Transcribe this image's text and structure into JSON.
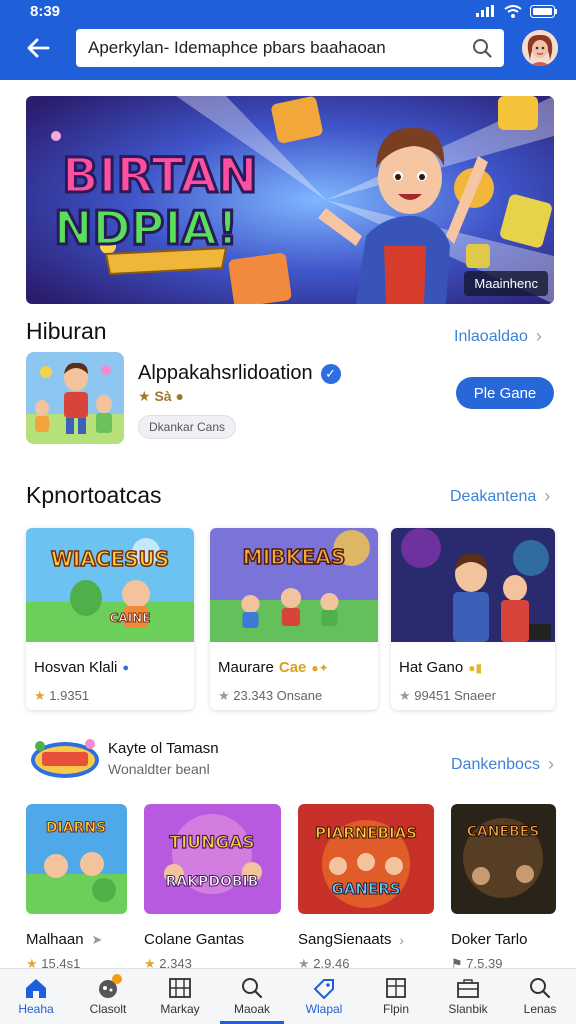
{
  "status": {
    "time": "8:39"
  },
  "search": {
    "value": "Aperkylan- Idemaphce pbars baahaoan"
  },
  "banner": {
    "title_line1": "BIRTAN",
    "title_line2": "NDPIA!",
    "tag": "Maainhenc"
  },
  "section1": {
    "title": "Hiburan",
    "link": "Inlaoaldao",
    "featured": {
      "name": "Alppakahsrlidoation",
      "rating": "★½\t★½",
      "rating_text": "★ Sà ●",
      "chip": "Dkankar Cans",
      "button": "Ple Gane"
    }
  },
  "section2": {
    "title": "Kpnortoatcas",
    "link": "Deakantena",
    "cards": [
      {
        "title": "Hosvan Klali",
        "badge": "●",
        "rating": "1.9351",
        "art": "WIACESUS",
        "art2": "CAINE"
      },
      {
        "title": "Maurare",
        "badge_text": "Cae",
        "rating": "23.343",
        "rating_extra": "Onsane",
        "art": "MIBKEAS"
      },
      {
        "title": "Hat Gano",
        "rating": "99451",
        "rating_extra": "Snaeer"
      }
    ]
  },
  "section3": {
    "title": "Kayte ol Tamasn",
    "subtitle": "Wonaldter beanl",
    "link": "Dankenbocs",
    "cards": [
      {
        "title": "Malhaan",
        "rating": "15.4s1",
        "art": "DIARNS"
      },
      {
        "title": "Colane Gantas",
        "rating": "2.343",
        "art": "TIUNGAS",
        "art2": "RAKPDOBIB"
      },
      {
        "title": "SangSienaats",
        "rating": "2.9.46",
        "art": "PIARNEBIAS",
        "art2": "GANERS"
      },
      {
        "title": "Doker Tarlo",
        "rating": "7.5.39",
        "art": "CANEBES"
      }
    ]
  },
  "nav": [
    {
      "label": "Heaha",
      "icon": "home-icon"
    },
    {
      "label": "Clasolt",
      "icon": "gamepad-icon"
    },
    {
      "label": "Markay",
      "icon": "grid-icon"
    },
    {
      "label": "Maoak",
      "icon": "search-icon"
    },
    {
      "label": "Wlapal",
      "icon": "tag-icon"
    },
    {
      "label": "Flpin",
      "icon": "book-icon"
    },
    {
      "label": "Slanbik",
      "icon": "briefcase-icon"
    },
    {
      "label": "Lenas",
      "icon": "magnifier-icon"
    }
  ],
  "colors": {
    "primary": "#1f5fd9",
    "link": "#3b82d8",
    "star": "#e3a52a"
  }
}
